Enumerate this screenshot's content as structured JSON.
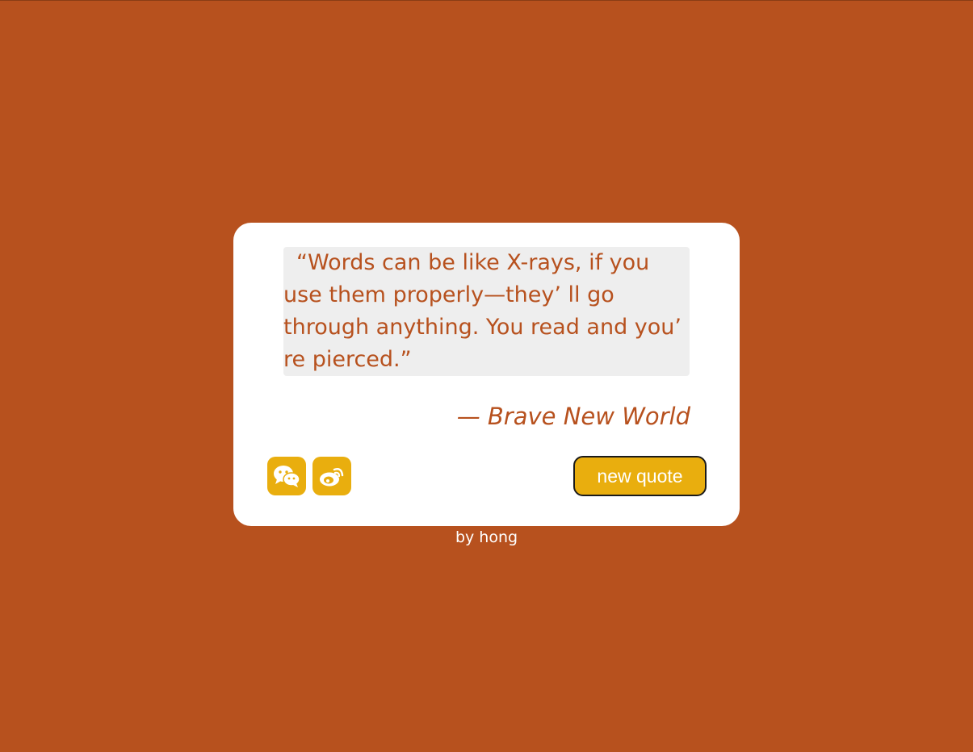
{
  "quote": {
    "text": "“Words can be like X-rays, if you use them properly—they’ ll go through anything. You read and you’ re pierced.”",
    "author": "— Brave New World"
  },
  "share": {
    "wechat_icon": "wechat-icon",
    "weibo_icon": "weibo-icon"
  },
  "actions": {
    "new_quote_label": "new quote"
  },
  "footer": {
    "byline": "by hong"
  },
  "colors": {
    "background": "#b7511e",
    "card": "#ffffff",
    "quote_box": "#eeeeee",
    "accent": "#e9ae0e",
    "text": "#b7511e"
  }
}
